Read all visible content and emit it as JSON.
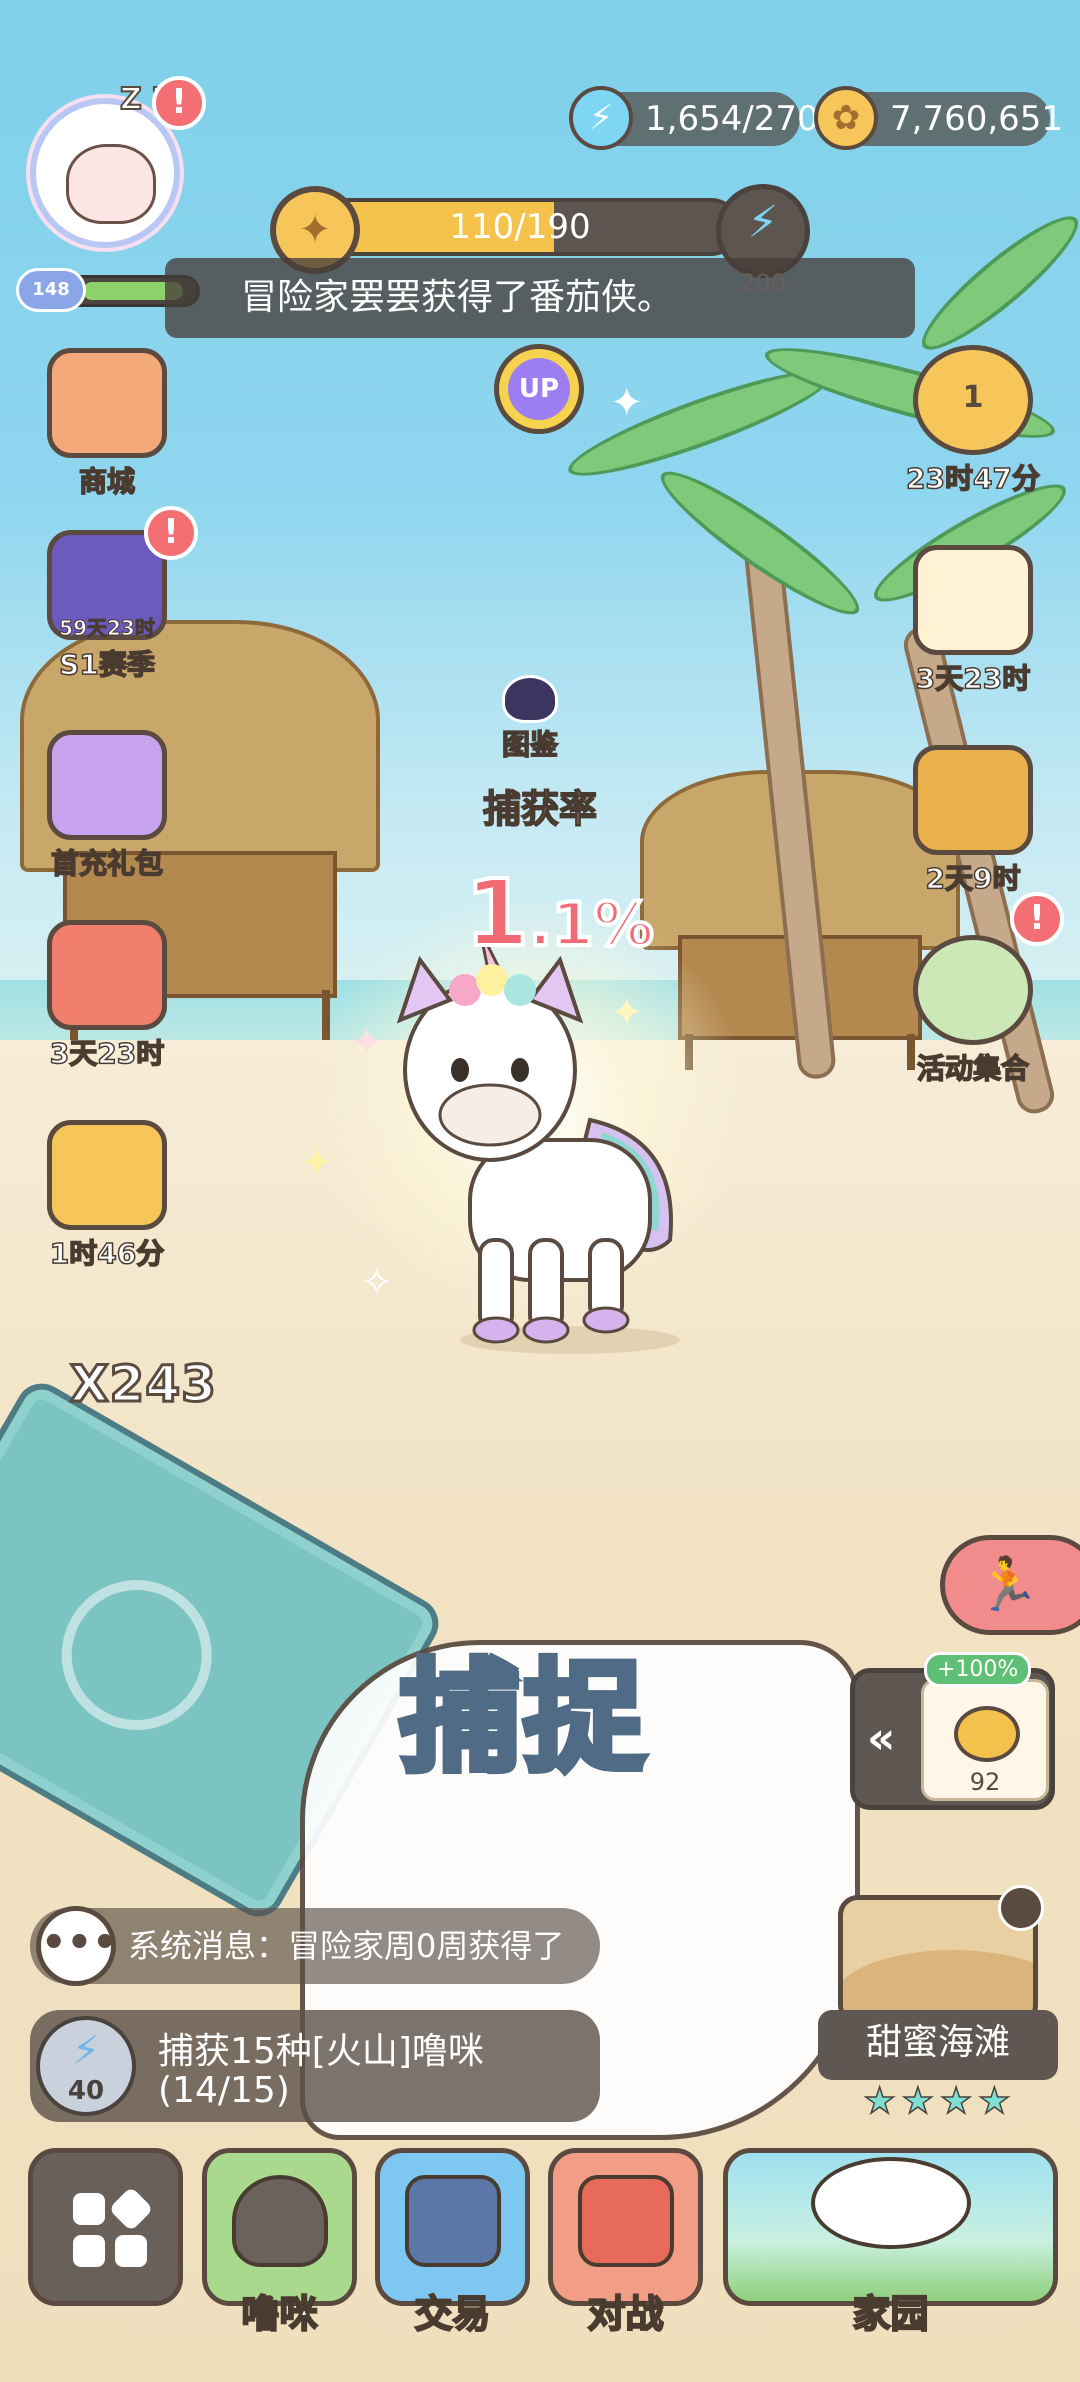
{
  "player": {
    "level": "148",
    "avatar_status": "Z Z",
    "alert": "!"
  },
  "resources": {
    "energy": "1,654/270",
    "gold": "7,760,651"
  },
  "progress": {
    "text": "110/190",
    "fill_fraction": 0.579,
    "energy_cost": "200"
  },
  "ticker": {
    "message": "冒险家罢罢获得了番茄侠。"
  },
  "up_button": {
    "label": "UP"
  },
  "left_menu": [
    {
      "label": "商城",
      "timer": "",
      "icon": "shop-icon",
      "alert": false
    },
    {
      "label": "S1赛季",
      "timer": "59天23时",
      "icon": "season-icon",
      "alert": true
    },
    {
      "label": "首充礼包",
      "timer": "",
      "icon": "gift-icon",
      "alert": false
    },
    {
      "label": "3天23时",
      "timer": "",
      "icon": "treasure-chest-icon",
      "alert": false
    },
    {
      "label": "1时46分",
      "timer": "",
      "icon": "penguin-box-icon",
      "alert": false
    }
  ],
  "right_menu": [
    {
      "label": "23时47分",
      "rank": "1",
      "icon": "trophy-icon",
      "alert": false
    },
    {
      "label": "3天23时",
      "icon": "map-scroll-icon",
      "alert": false
    },
    {
      "label": "2天9时",
      "icon": "badge-icon",
      "alert": false
    },
    {
      "label": "活动集合",
      "icon": "activity-wreath-icon",
      "alert": true
    }
  ],
  "center": {
    "collection_label": "图鉴",
    "capture_rate_label": "捕获率",
    "capture_rate_int": "1",
    "capture_rate_dec": ".1%",
    "card_count": "X243",
    "catch_label": "捕捉"
  },
  "candy": {
    "bonus": "+100%",
    "count": "92",
    "arrows": "«"
  },
  "system_message": {
    "icon_label": "•••",
    "text": "系统消息：冒险家周0周获得了"
  },
  "quest": {
    "energy": "40",
    "line1": "捕获15种[火山]噜咪",
    "line2": "(14/15)"
  },
  "location": {
    "name": "甜蜜海滩",
    "stars": "★★★★"
  },
  "nav": [
    {
      "label": "",
      "icon": "menu-grid-icon"
    },
    {
      "label": "噜咪",
      "icon": "lumi-icon"
    },
    {
      "label": "交易",
      "icon": "trade-icon"
    },
    {
      "label": "对战",
      "icon": "battle-icon"
    },
    {
      "label": "家园",
      "icon": "home-icon"
    }
  ],
  "colors": {
    "alert_red": "#f36f73",
    "rate_pink": "#f06b73",
    "gold": "#f6c65a",
    "energy_blue": "#7fd6f4"
  }
}
